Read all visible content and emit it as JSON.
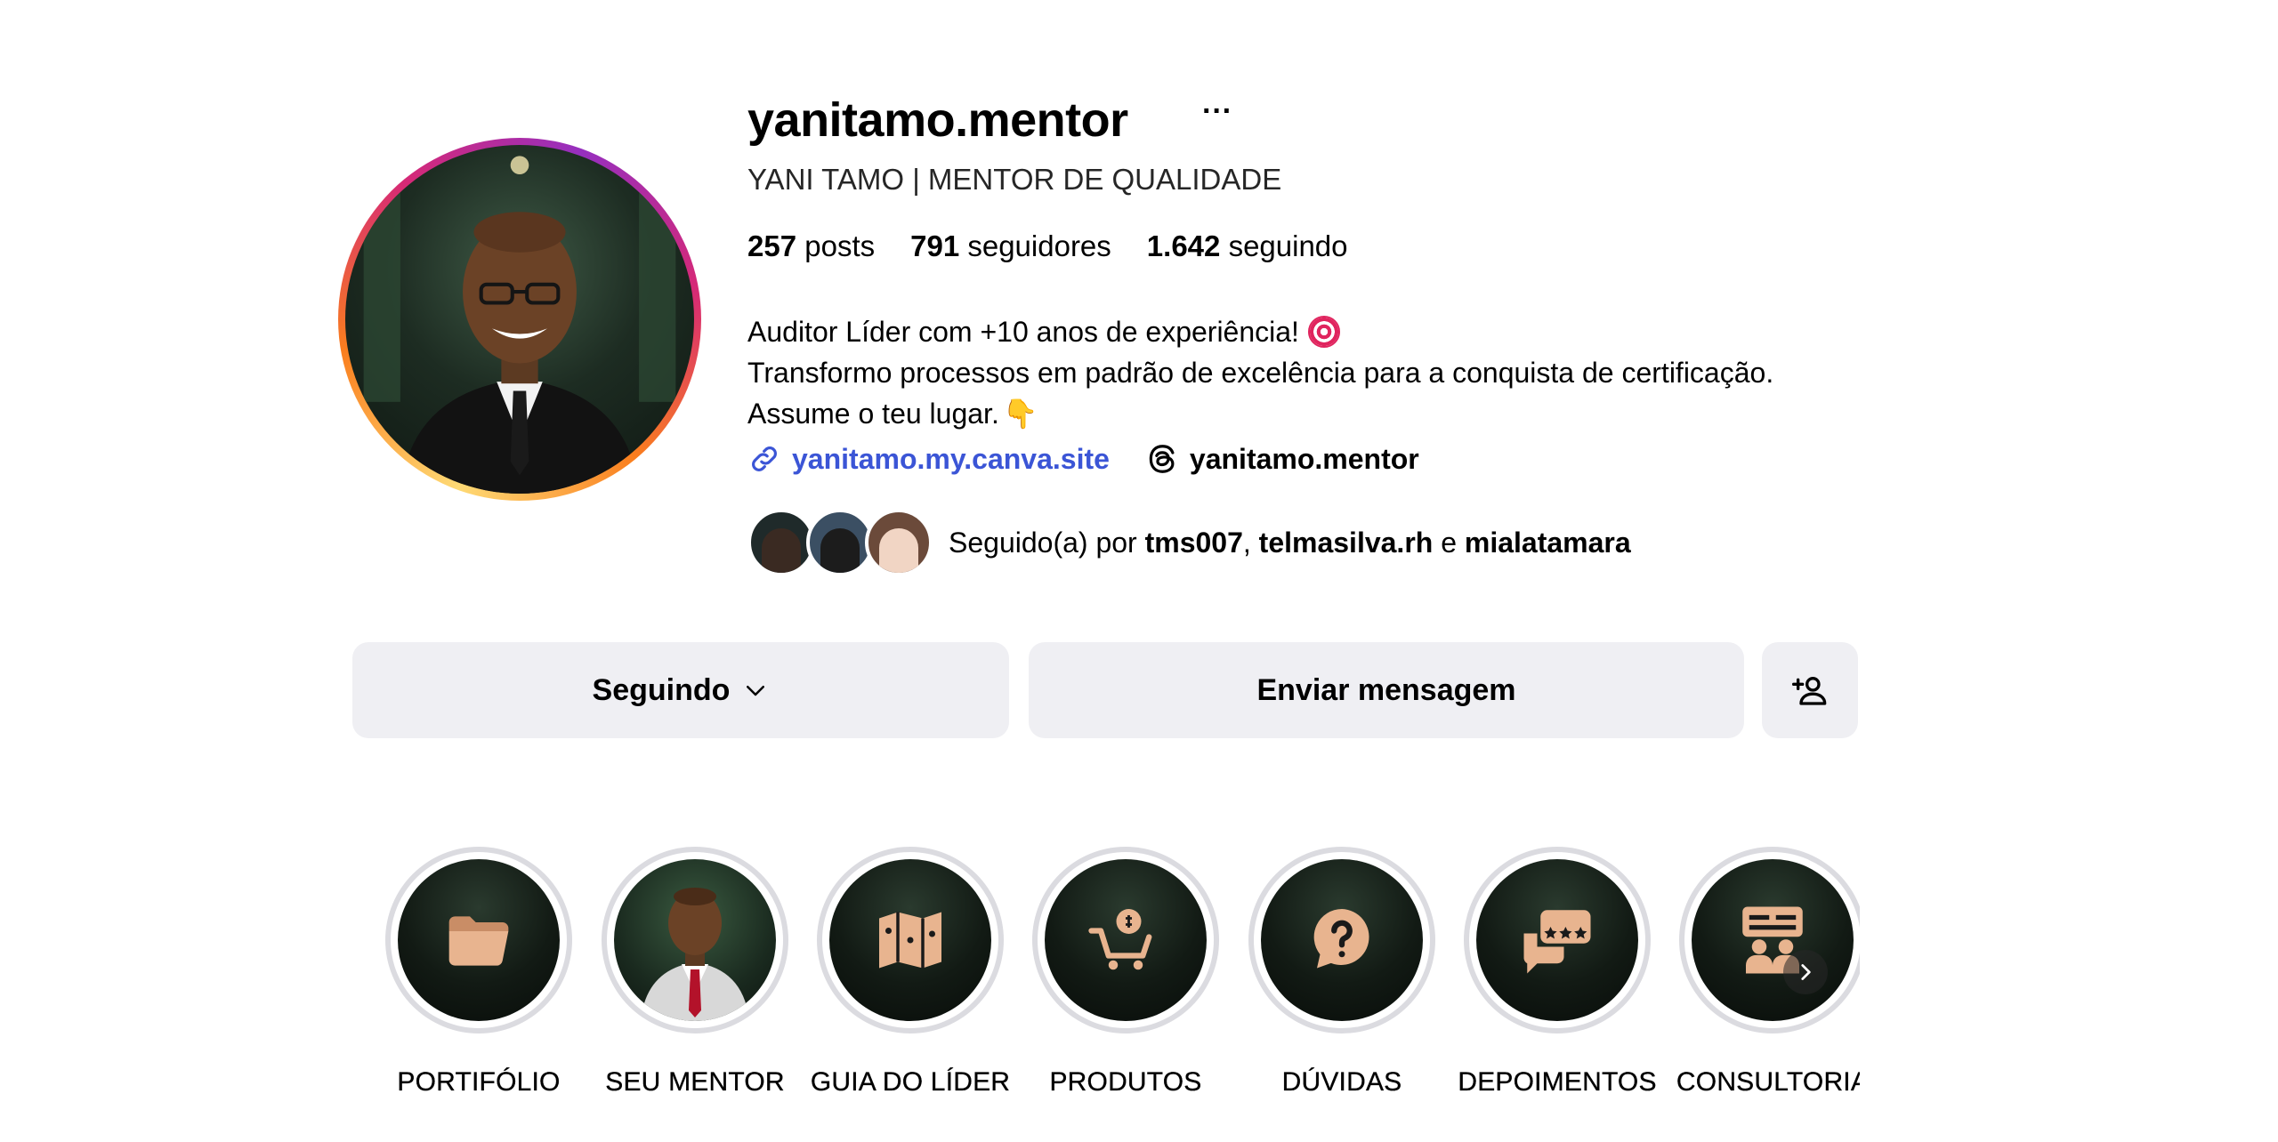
{
  "profile": {
    "username": "yanitamo.mentor",
    "more_label": "···",
    "full_name": "YANI TAMO | MENTOR DE QUALIDADE",
    "stats": {
      "posts_count": "257",
      "posts_label": "posts",
      "followers_count": "791",
      "followers_label": "seguidores",
      "following_count": "1.642",
      "following_label": "seguindo"
    },
    "bio": {
      "line1": "Auditor Líder com +10 anos de experiência!",
      "line2": "Transformo processos em padrão de excelência para a conquista de certificação.",
      "line3": "Assume o teu lugar.",
      "emoji_line1": "direct-hit-emoji",
      "emoji_line3": "pointing-down-emoji"
    },
    "website": "yanitamo.my.canva.site",
    "threads_handle": "yanitamo.mentor",
    "followed_by": {
      "prefix": "Seguido(a) por",
      "user1": "tms007",
      "sep1": ",",
      "user2": "telmasilva.rh",
      "sep2": "e",
      "user3": "mialatamara"
    }
  },
  "actions": {
    "following_label": "Seguindo",
    "message_label": "Enviar mensagem",
    "suggest_icon": "add-person-icon"
  },
  "highlights": [
    {
      "label": "PORTIFÓLIO",
      "icon": "folder-icon"
    },
    {
      "label": "SEU MENTOR",
      "icon": "mentor-photo"
    },
    {
      "label": "GUIA DO LÍDER",
      "icon": "map-icon"
    },
    {
      "label": "PRODUTOS",
      "icon": "shopping-cart-icon"
    },
    {
      "label": "DÚVIDAS",
      "icon": "question-bubble-icon"
    },
    {
      "label": "DEPOIMENTOS",
      "icon": "reviews-chat-icon"
    },
    {
      "label": "CONSULTORIA",
      "icon": "consulting-board-icon"
    }
  ],
  "colors": {
    "link": "#3b55d6",
    "button_bg": "#efeff3",
    "highlight_icon": "#e8b48f"
  }
}
